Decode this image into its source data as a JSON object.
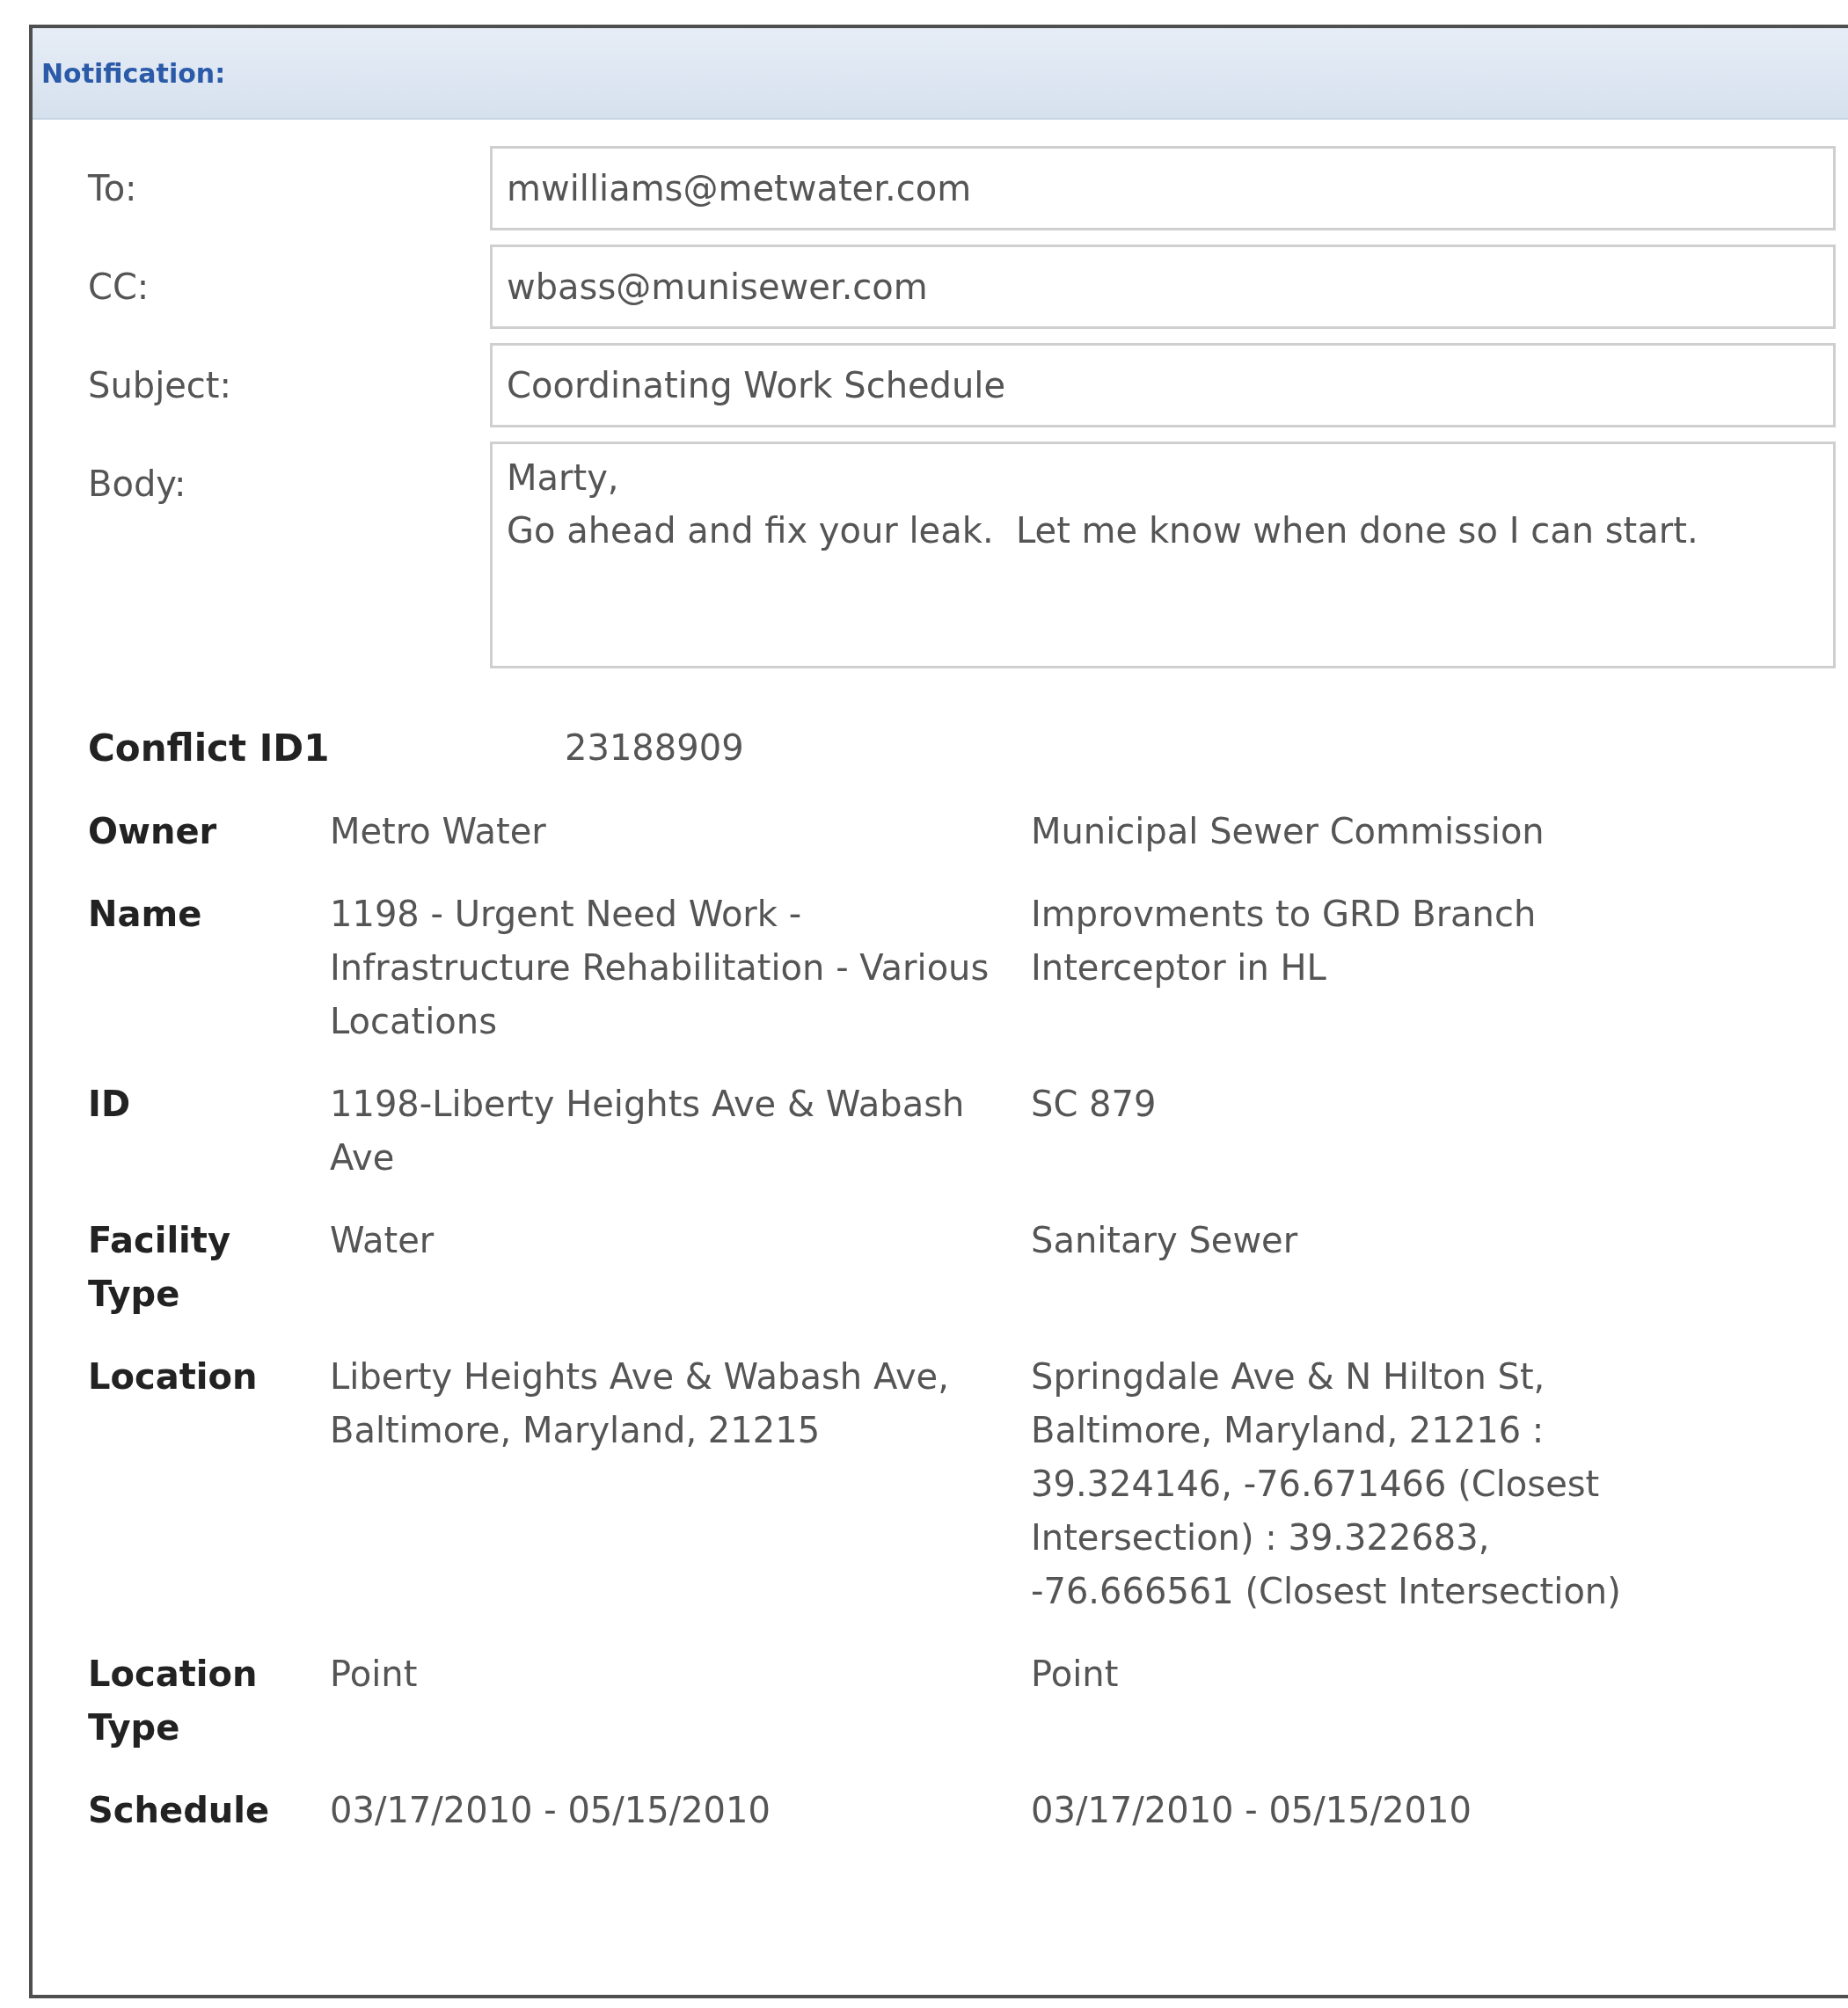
{
  "panel": {
    "title": "Notification:"
  },
  "fields": [
    {
      "label": "To:",
      "value": "mwilliams@metwater.com",
      "kind": "line"
    },
    {
      "label": "CC:",
      "value": "wbass@munisewer.com",
      "kind": "line"
    },
    {
      "label": "Subject:",
      "value": "Coordinating Work Schedule",
      "kind": "line"
    },
    {
      "label": "Body:",
      "value": "Marty,\nGo ahead and fix your leak.  Let me know when done so I can start.",
      "kind": "multiline"
    }
  ],
  "conflict": {
    "label": "Conflict ID1",
    "value": "23188909"
  },
  "details": [
    {
      "label": "Owner",
      "values": [
        "Metro Water",
        "Municipal Sewer Commission"
      ]
    },
    {
      "label": "Name",
      "values": [
        "1198 - Urgent Need Work - Infrastructure Rehabilitation - Various Locations",
        "Improvments to GRD Branch Interceptor in HL"
      ]
    },
    {
      "label": "ID",
      "values": [
        "1198-Liberty Heights Ave & Wabash Ave",
        "SC 879"
      ]
    },
    {
      "label": "Facility Type",
      "values": [
        "Water",
        "Sanitary Sewer"
      ]
    },
    {
      "label": "Location",
      "values": [
        "Liberty Heights Ave & Wabash Ave, Baltimore, Maryland, 21215",
        "Springdale Ave & N Hilton St, Baltimore, Maryland, 21216 : 39.324146, -76.671466 (Closest Intersection) : 39.322683, -76.666561 (Closest Intersection)"
      ]
    },
    {
      "label": "Location Type",
      "values": [
        "Point",
        "Point"
      ]
    },
    {
      "label": "Schedule",
      "values": [
        "03/17/2010 - 05/15/2010",
        "03/17/2010 - 05/15/2010"
      ]
    }
  ]
}
